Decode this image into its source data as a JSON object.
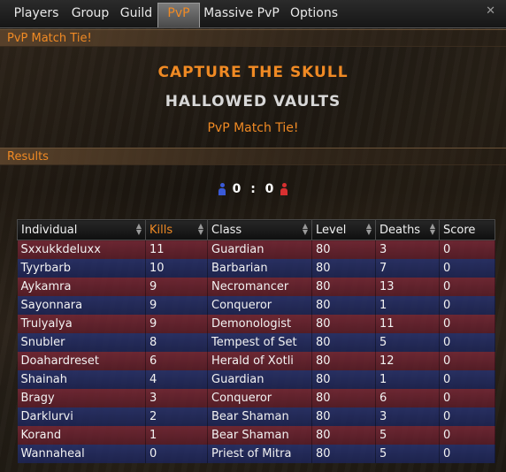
{
  "tabs": [
    "Players",
    "Group",
    "Guild",
    "PvP",
    "Massive PvP",
    "Options"
  ],
  "active_tab": "PvP",
  "close_icon": "close-icon",
  "header": {
    "title": "PvP Match Tie!"
  },
  "match": {
    "mode": "Capture the Skull",
    "map": "Hallowed Vaults",
    "result": "PvP Match Tie!"
  },
  "results_section": {
    "title": "Results"
  },
  "score": {
    "blue": "0",
    "separator": ":",
    "red": "0"
  },
  "colors": {
    "accent": "#f08a24",
    "red_team": "#7a2837",
    "blue_team": "#232c6e"
  },
  "table": {
    "columns": [
      "Individual",
      "Kills",
      "Class",
      "Level",
      "Deaths",
      "Score"
    ],
    "sorted_column": "Kills",
    "rows": [
      {
        "team": "red",
        "name": "Sxxukkdeluxx",
        "kills": "11",
        "class": "Guardian",
        "level": "80",
        "deaths": "3",
        "score": "0"
      },
      {
        "team": "blue",
        "name": "Tyyrbarb",
        "kills": "10",
        "class": "Barbarian",
        "level": "80",
        "deaths": "7",
        "score": "0"
      },
      {
        "team": "red",
        "name": "Aykamra",
        "kills": "9",
        "class": "Necromancer",
        "level": "80",
        "deaths": "13",
        "score": "0"
      },
      {
        "team": "blue",
        "name": "Sayonnara",
        "kills": "9",
        "class": "Conqueror",
        "level": "80",
        "deaths": "1",
        "score": "0"
      },
      {
        "team": "red",
        "name": "Trulyalya",
        "kills": "9",
        "class": "Demonologist",
        "level": "80",
        "deaths": "11",
        "score": "0"
      },
      {
        "team": "blue",
        "name": "Snubler",
        "kills": "8",
        "class": "Tempest of Set",
        "level": "80",
        "deaths": "5",
        "score": "0"
      },
      {
        "team": "red",
        "name": "Doahardreset",
        "kills": "6",
        "class": "Herald of Xotli",
        "level": "80",
        "deaths": "12",
        "score": "0"
      },
      {
        "team": "blue",
        "name": "Shainah",
        "kills": "4",
        "class": "Guardian",
        "level": "80",
        "deaths": "1",
        "score": "0"
      },
      {
        "team": "red",
        "name": "Bragy",
        "kills": "3",
        "class": "Conqueror",
        "level": "80",
        "deaths": "6",
        "score": "0"
      },
      {
        "team": "blue",
        "name": "Darklurvi",
        "kills": "2",
        "class": "Bear Shaman",
        "level": "80",
        "deaths": "3",
        "score": "0"
      },
      {
        "team": "red",
        "name": "Korand",
        "kills": "1",
        "class": "Bear Shaman",
        "level": "80",
        "deaths": "5",
        "score": "0"
      },
      {
        "team": "blue",
        "name": "Wannaheal",
        "kills": "0",
        "class": "Priest of Mitra",
        "level": "80",
        "deaths": "5",
        "score": "0"
      }
    ]
  }
}
